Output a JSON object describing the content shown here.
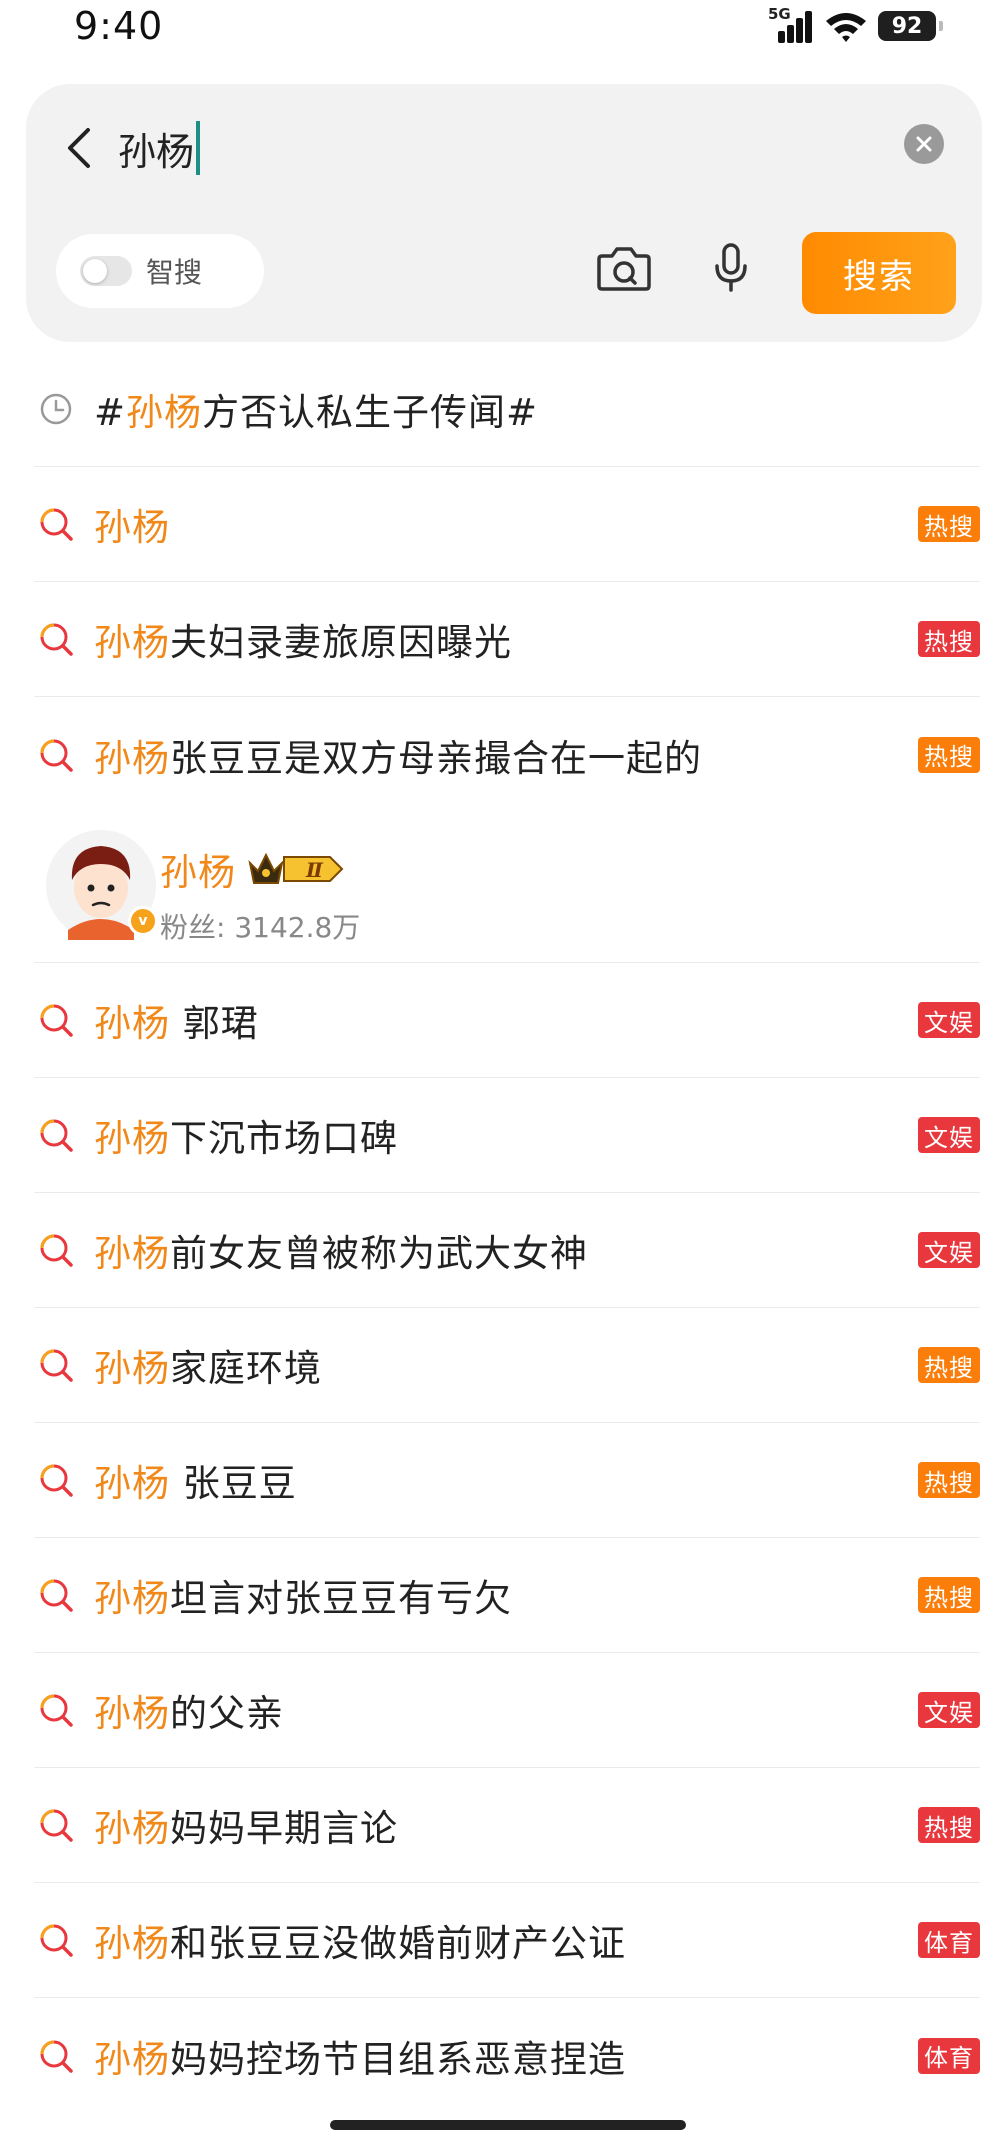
{
  "status_bar": {
    "time": "9:40",
    "network": "5G",
    "battery": "92"
  },
  "search": {
    "query": "孙杨",
    "smart_search_label": "智搜",
    "search_button_label": "搜索"
  },
  "colors": {
    "highlight": "#f0881a",
    "tag_hot": "#fb7d0a",
    "tag_red": "#e8383d",
    "search_button": "#ff8a00"
  },
  "history_item": {
    "icon": "clock-icon",
    "prefix": "#",
    "highlight": "孙杨",
    "rest": "方否认私生子传闻#"
  },
  "user_card": {
    "name": "孙杨",
    "badge": "Ⅱ",
    "fans": "粉丝: 3142.8万",
    "verified": "v"
  },
  "suggestions_top": [
    {
      "highlight": "孙杨",
      "rest": "",
      "tag": "热搜",
      "tag_color": "#fb7d0a"
    },
    {
      "highlight": "孙杨",
      "rest": "夫妇录妻旅原因曝光",
      "tag": "热搜",
      "tag_color": "#e8383d"
    },
    {
      "highlight": "孙杨",
      "rest": "张豆豆是双方母亲撮合在一起的",
      "tag": "热搜",
      "tag_color": "#fb7d0a"
    }
  ],
  "suggestions_bottom": [
    {
      "highlight": "孙杨",
      "rest": " 郭珺",
      "tag": "文娱",
      "tag_color": "#e8383d"
    },
    {
      "highlight": "孙杨",
      "rest": "下沉市场口碑",
      "tag": "文娱",
      "tag_color": "#e8383d"
    },
    {
      "highlight": "孙杨",
      "rest": "前女友曾被称为武大女神",
      "tag": "文娱",
      "tag_color": "#e8383d"
    },
    {
      "highlight": "孙杨",
      "rest": "家庭环境",
      "tag": "热搜",
      "tag_color": "#fb7d0a"
    },
    {
      "highlight": "孙杨",
      "rest": " 张豆豆",
      "tag": "热搜",
      "tag_color": "#fb7d0a"
    },
    {
      "highlight": "孙杨",
      "rest": "坦言对张豆豆有亏欠",
      "tag": "热搜",
      "tag_color": "#fb7d0a"
    },
    {
      "highlight": "孙杨",
      "rest": "的父亲",
      "tag": "文娱",
      "tag_color": "#e8383d"
    },
    {
      "highlight": "孙杨",
      "rest": "妈妈早期言论",
      "tag": "热搜",
      "tag_color": "#e8383d"
    },
    {
      "highlight": "孙杨",
      "rest": "和张豆豆没做婚前财产公证",
      "tag": "体育",
      "tag_color": "#e8383d"
    },
    {
      "highlight": "孙杨",
      "rest": "妈妈控场节目组系恶意捏造",
      "tag": "体育",
      "tag_color": "#e8383d"
    }
  ]
}
